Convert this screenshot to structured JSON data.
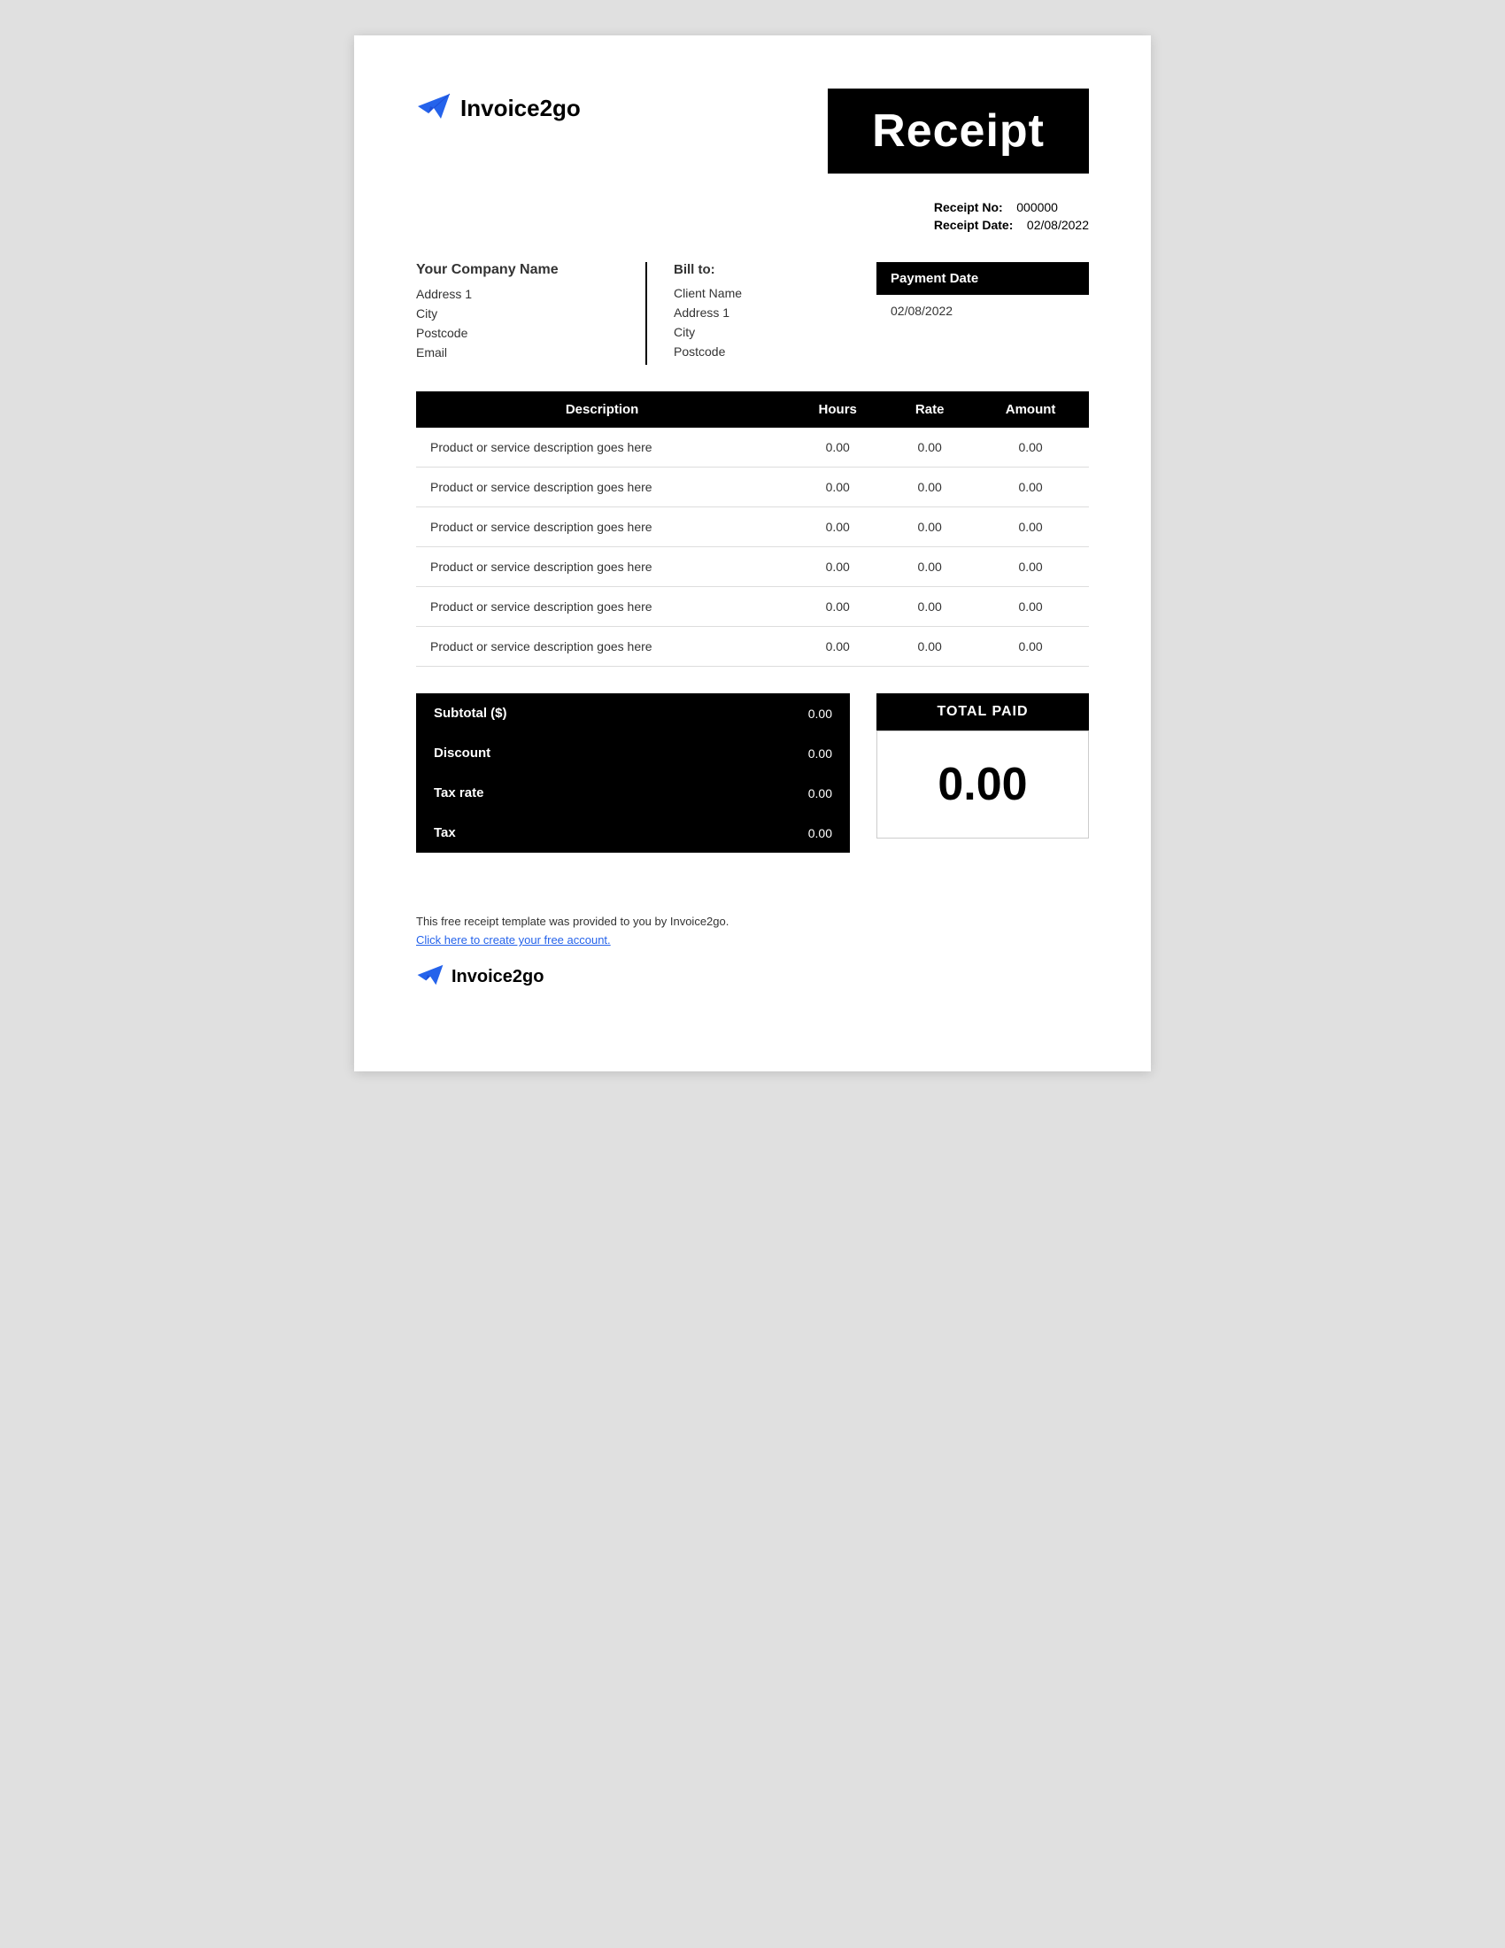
{
  "header": {
    "logo_text": "Invoice2go",
    "receipt_title": "Receipt"
  },
  "receipt_meta": {
    "receipt_no_label": "Receipt No:",
    "receipt_no_value": "000000",
    "receipt_date_label": "Receipt Date:",
    "receipt_date_value": "02/08/2022"
  },
  "company": {
    "name": "Your Company Name",
    "address1": "Address 1",
    "city": "City",
    "postcode": "Postcode",
    "email": "Email"
  },
  "bill_to": {
    "label": "Bill to:",
    "client_name": "Client Name",
    "address1": "Address 1",
    "city": "City",
    "postcode": "Postcode"
  },
  "payment_date": {
    "label": "Payment Date",
    "value": "02/08/2022"
  },
  "table": {
    "headers": {
      "description": "Description",
      "hours": "Hours",
      "rate": "Rate",
      "amount": "Amount"
    },
    "rows": [
      {
        "description": "Product or service description goes here",
        "hours": "0.00",
        "rate": "0.00",
        "amount": "0.00"
      },
      {
        "description": "Product or service description goes here",
        "hours": "0.00",
        "rate": "0.00",
        "amount": "0.00"
      },
      {
        "description": "Product or service description goes here",
        "hours": "0.00",
        "rate": "0.00",
        "amount": "0.00"
      },
      {
        "description": "Product or service description goes here",
        "hours": "0.00",
        "rate": "0.00",
        "amount": "0.00"
      },
      {
        "description": "Product or service description goes here",
        "hours": "0.00",
        "rate": "0.00",
        "amount": "0.00"
      },
      {
        "description": "Product or service description goes here",
        "hours": "0.00",
        "rate": "0.00",
        "amount": "0.00"
      }
    ]
  },
  "subtotals": [
    {
      "label": "Subtotal ($)",
      "value": "0.00"
    },
    {
      "label": "Discount",
      "value": "0.00"
    },
    {
      "label": "Tax rate",
      "value": "0.00"
    },
    {
      "label": "Tax",
      "value": "0.00"
    }
  ],
  "total_paid": {
    "label": "TOTAL PAID",
    "value": "0.00"
  },
  "footer": {
    "text": "This free receipt  template was provided to you by Invoice2go.",
    "link_text": "Click here to create your free account.",
    "logo_text": "Invoice2go"
  }
}
